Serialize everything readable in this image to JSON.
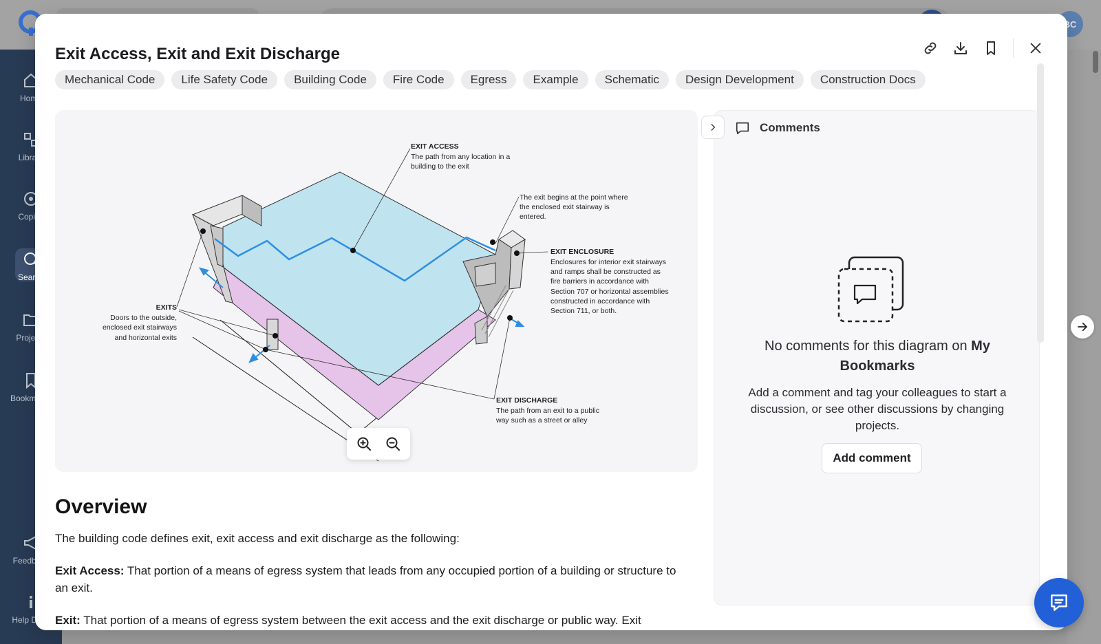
{
  "background": {
    "avatar_initials": "BC",
    "sidebar": [
      {
        "label": "Home",
        "icon": "home-icon"
      },
      {
        "label": "Library",
        "icon": "library-icon"
      },
      {
        "label": "Copilot",
        "icon": "copilot-icon"
      },
      {
        "label": "Search",
        "icon": "search-icon"
      },
      {
        "label": "Projects",
        "icon": "folder-icon"
      },
      {
        "label": "Bookmarks",
        "icon": "bookmark-icon"
      },
      {
        "label": "Feedback",
        "icon": "megaphone-icon"
      },
      {
        "label": "Help Desk",
        "icon": "info-icon"
      }
    ]
  },
  "modal": {
    "title": "Exit Access, Exit and Exit Discharge",
    "actions": [
      "link-icon",
      "download-icon",
      "bookmark-icon",
      "close-icon"
    ],
    "tags": [
      "Mechanical Code",
      "Life Safety Code",
      "Building Code",
      "Fire Code",
      "Egress",
      "Example",
      "Schematic",
      "Design Development",
      "Construction Docs"
    ],
    "diagram": {
      "labels": {
        "exit_access_title": "EXIT ACCESS",
        "exit_access_line1": "The path from any location in a",
        "exit_access_line2": "building to the exit",
        "exit_begins_line1": "The exit begins at the point where",
        "exit_begins_line2": "the enclosed exit stairway is",
        "exit_begins_line3": "entered.",
        "exit_enclosure_title": "EXIT ENCLOSURE",
        "exit_enclosure_line1": "Enclosures for interior exit stairways",
        "exit_enclosure_line2": "and ramps shall be constructed as",
        "exit_enclosure_line3": "fire barriers in accordance with",
        "exit_enclosure_line4": "Section 707 or horizontal assemblies",
        "exit_enclosure_line5": "constructed in accordance with",
        "exit_enclosure_line6": "Section 711, or both.",
        "exits_title": "EXITS",
        "exits_line1": "Doors to the outside,",
        "exits_line2": "enclosed exit stairways",
        "exits_line3": "and horizontal exits",
        "exit_discharge_title": "EXIT DISCHARGE",
        "exit_discharge_line1": "The path from an exit to a public",
        "exit_discharge_line2": "way such as a street or alley"
      },
      "colors": {
        "floor": "#bfe3ef",
        "discharge": "#e6c4ea",
        "path": "#2d8fe0"
      },
      "zoom_in_icon": "zoom-in-icon",
      "zoom_out_icon": "zoom-out-icon"
    },
    "overview": {
      "heading": "Overview",
      "intro": "The building code defines exit, exit access and exit discharge as the following:",
      "items": [
        {
          "term": "Exit Access:",
          "text": " That portion of a means of egress system that leads from any occupied portion of a building or structure to an exit."
        },
        {
          "term": "Exit:",
          "text": " That portion of a means of egress system between the exit access and the exit discharge or public way. Exit"
        }
      ]
    },
    "comments": {
      "title": "Comments",
      "empty_prefix": "No comments for this diagram on ",
      "empty_project": "My Bookmarks",
      "empty_desc": "Add a comment and tag your colleagues to start a discussion, or see other discussions by changing projects.",
      "add_button": "Add comment"
    }
  },
  "colors": {
    "accent": "#2160d6",
    "sidebar": "#283b54"
  }
}
